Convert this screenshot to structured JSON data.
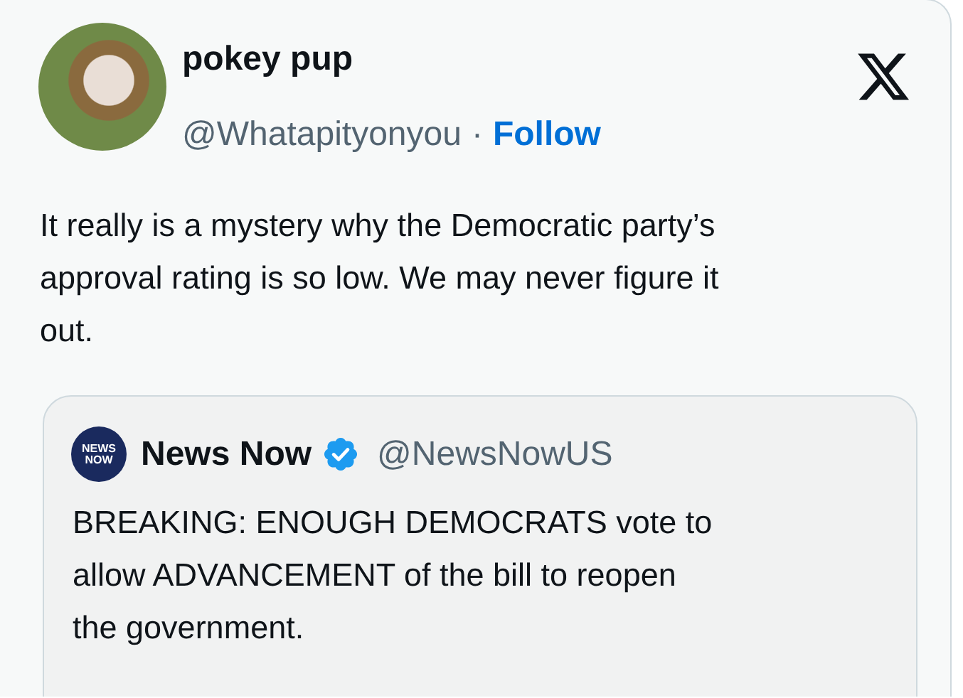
{
  "post": {
    "author_name": "pokey pup",
    "handle": "@Whatapityonyou",
    "separator": "·",
    "follow_label": "Follow",
    "text_lines": [
      "It really is a mystery why the Democratic party’s",
      "approval rating is so low. We may never figure it",
      "out."
    ],
    "quoted_post": {
      "avatar_logo_lines": [
        "NEWS",
        "NOW"
      ],
      "author_name": "News Now",
      "verified": true,
      "handle": "@NewsNowUS",
      "text_lines": [
        "BREAKING: ENOUGH DEMOCRATS vote to",
        "allow ADVANCEMENT of the bill to reopen",
        "the government."
      ]
    }
  }
}
